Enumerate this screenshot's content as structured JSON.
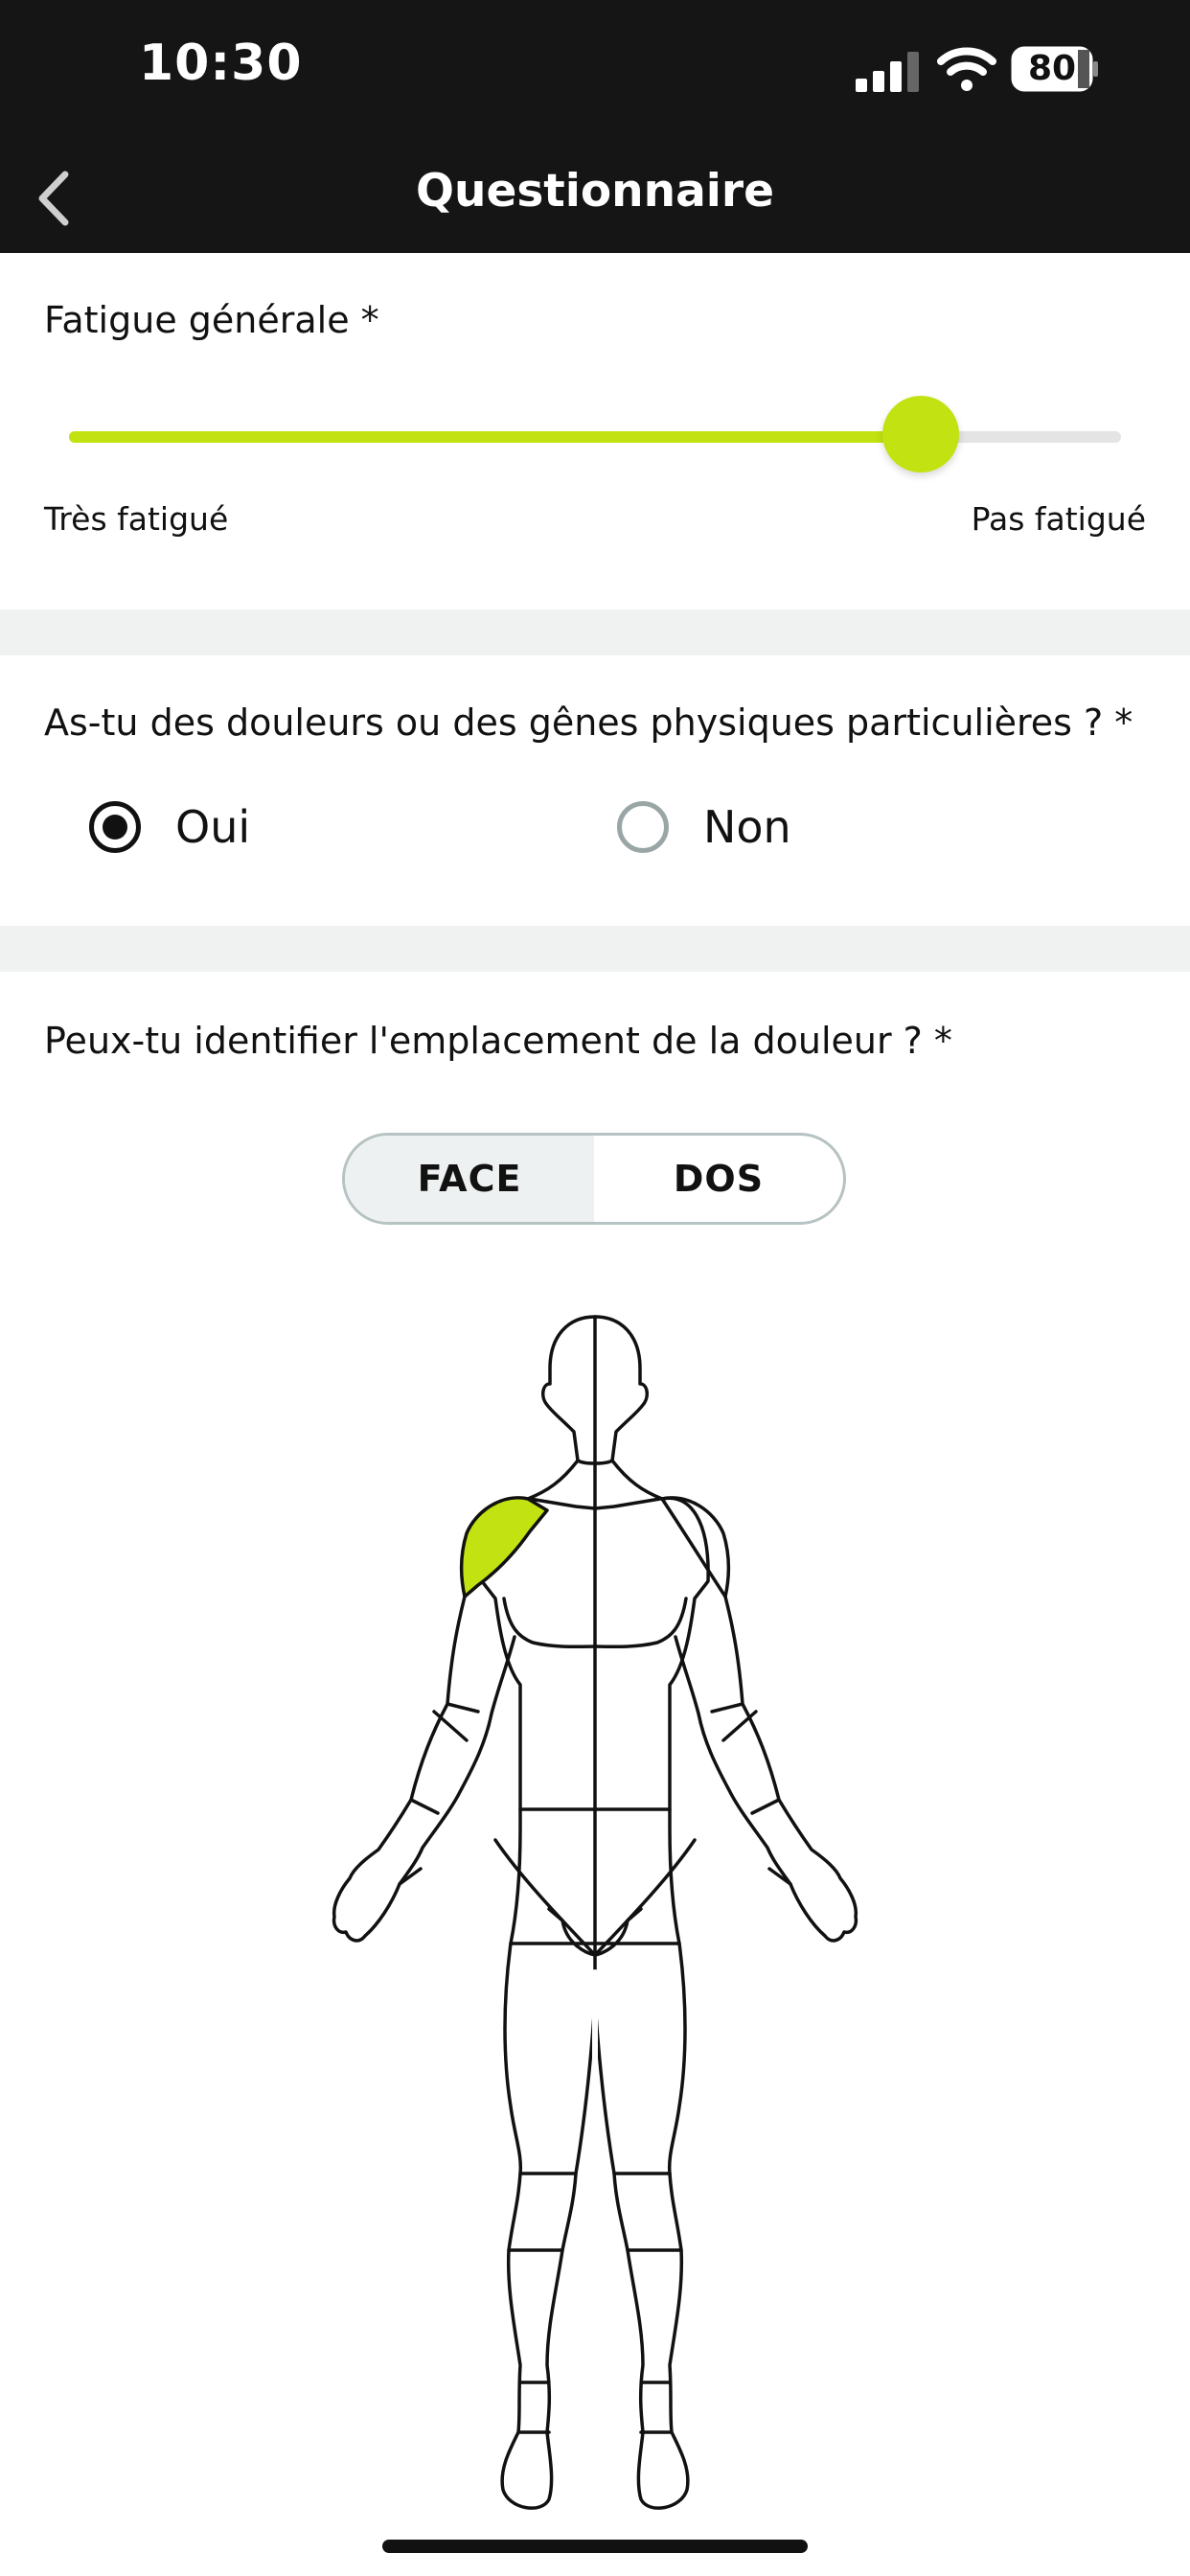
{
  "status_bar": {
    "time": "10:30",
    "battery_level": "80",
    "icons": [
      "signal-icon",
      "wifi-icon",
      "battery-icon"
    ]
  },
  "nav": {
    "back_icon": "chevron-left-icon",
    "title": "Questionnaire"
  },
  "fatigue": {
    "label": "Fatigue générale *",
    "min_label": "Très fatigué",
    "max_label": "Pas fatigué",
    "value_fraction": 0.81
  },
  "pain": {
    "question": "As-tu des douleurs ou des gênes physiques particulières ? *",
    "options": [
      {
        "label": "Oui",
        "selected": true
      },
      {
        "label": "Non",
        "selected": false
      }
    ]
  },
  "location": {
    "question": "Peux-tu identifier l'emplacement de la douleur ? *",
    "view_options": [
      "FACE",
      "DOS"
    ],
    "selected_view": "FACE",
    "highlighted_regions": [
      "right-shoulder"
    ]
  },
  "colors": {
    "accent": "#c3e211",
    "header_bg": "#151515",
    "separator": "#f0f2f2",
    "radio_inactive": "#9aa6a6"
  }
}
